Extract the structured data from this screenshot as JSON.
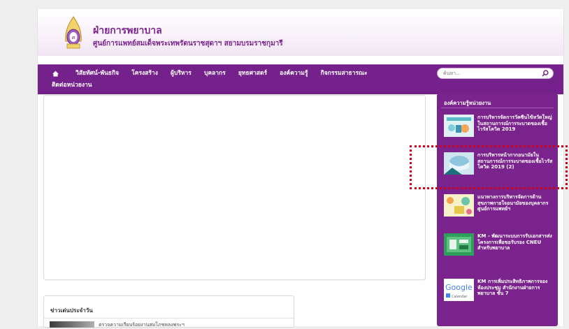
{
  "header": {
    "title": "ฝ่ายการพยาบาล",
    "subtitle": "ศูนย์การแพทย์สมเด็จพระเทพรัตนราชสุดาฯ สยามบรมราชกุมารี"
  },
  "nav": {
    "items": [
      {
        "label": "วิสัยทัศน์-พันธกิจ"
      },
      {
        "label": "โครงสร้าง"
      },
      {
        "label": "ผู้บริหาร"
      },
      {
        "label": "บุคลากร"
      },
      {
        "label": "ยุทธศาสตร์"
      },
      {
        "label": "องค์ความรู้"
      },
      {
        "label": "กิจกรรมสาธารณะ"
      },
      {
        "label": "ติดต่อหน่วยงาน"
      }
    ],
    "search_placeholder": "ค้นหา..."
  },
  "news": {
    "title": "ข่าวเด่นประจำวัน",
    "first_item": "ตรวจความเรียบร้อยงานสมโภชหลงพระฯ"
  },
  "sidebar": {
    "title": "องค์ความรู้หน่วยงาน",
    "posts": [
      {
        "title": "การบริหารจัดการวัคซีนไข้หวัดใหญ่ในสถานการณ์การระบาดของเชื้อไวรัสโควิด 2019"
      },
      {
        "title": "การบริหารหน้ากากอนามัยในสถานการณ์การระบาดของเชื้อไวรัสโควิด 2019 (2)"
      },
      {
        "title": "แนวทางการบริหารจัดการด้านสุขภาพกายใจอนามัยของบุคลากรศูนย์การแพทย์ฯ"
      },
      {
        "title": "KM - พัฒนาระบบการรับเอกสารส่งโครงการเพื่อขอรับรอง CNEU สำหรับพยาบาล"
      },
      {
        "title": "KM การเพิ่มประสิทธิภาพการจองห้องประชุม สำนักงานฝ่ายการพยาบาล ชั้น 7",
        "thumb_label": "Google",
        "thumb_sub": "Calendar"
      }
    ]
  },
  "colors": {
    "brand_purple": "#75218c",
    "highlight_red": "#d0021b"
  }
}
